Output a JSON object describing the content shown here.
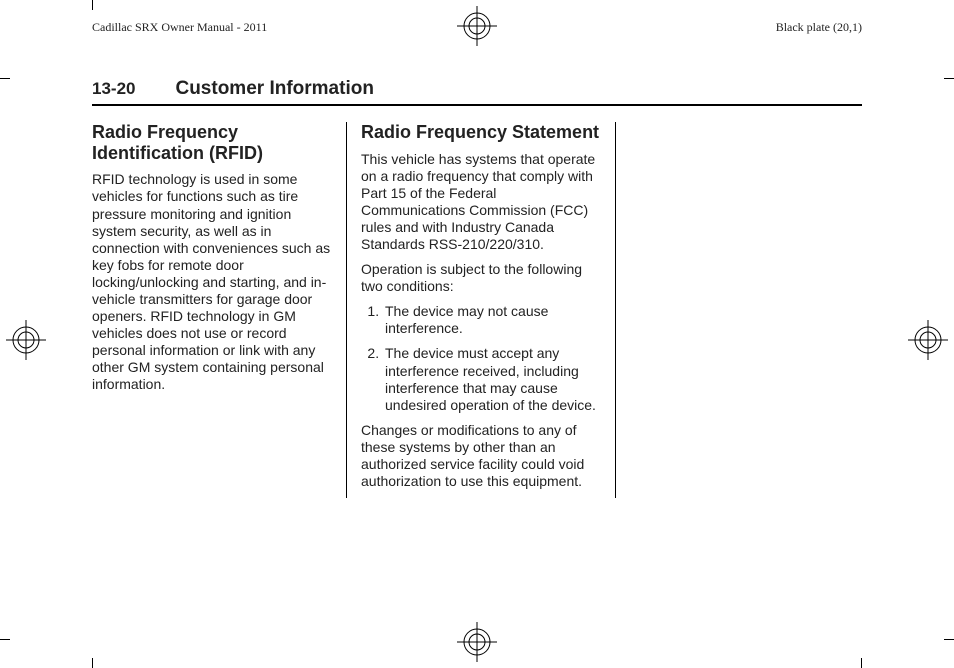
{
  "meta": {
    "doc_title": "Cadillac SRX Owner Manual - 2011",
    "plate": "Black plate (20,1)"
  },
  "header": {
    "page_number": "13-20",
    "section_title": "Customer Information"
  },
  "col1": {
    "heading": "Radio Frequency Identification (RFID)",
    "body": "RFID technology is used in some vehicles for functions such as tire pressure monitoring and ignition system security, as well as in connection with conveniences such as key fobs for remote door locking/unlocking and starting, and in-vehicle transmitters for garage door openers. RFID technology in GM vehicles does not use or record personal information or link with any other GM system containing personal information."
  },
  "col2": {
    "heading": "Radio Frequency Statement",
    "p1": "This vehicle has systems that operate on a radio frequency that comply with Part 15 of the Federal Communications Commission (FCC) rules and with Industry Canada Standards RSS-210/220/310.",
    "p2": "Operation is subject to the following two conditions:",
    "li1": "The device may not cause interference.",
    "li2": "The device must accept any interference received, including interference that may cause undesired operation of the device.",
    "p3": "Changes or modifications to any of these systems by other than an authorized service facility could void authorization to use this equipment."
  }
}
